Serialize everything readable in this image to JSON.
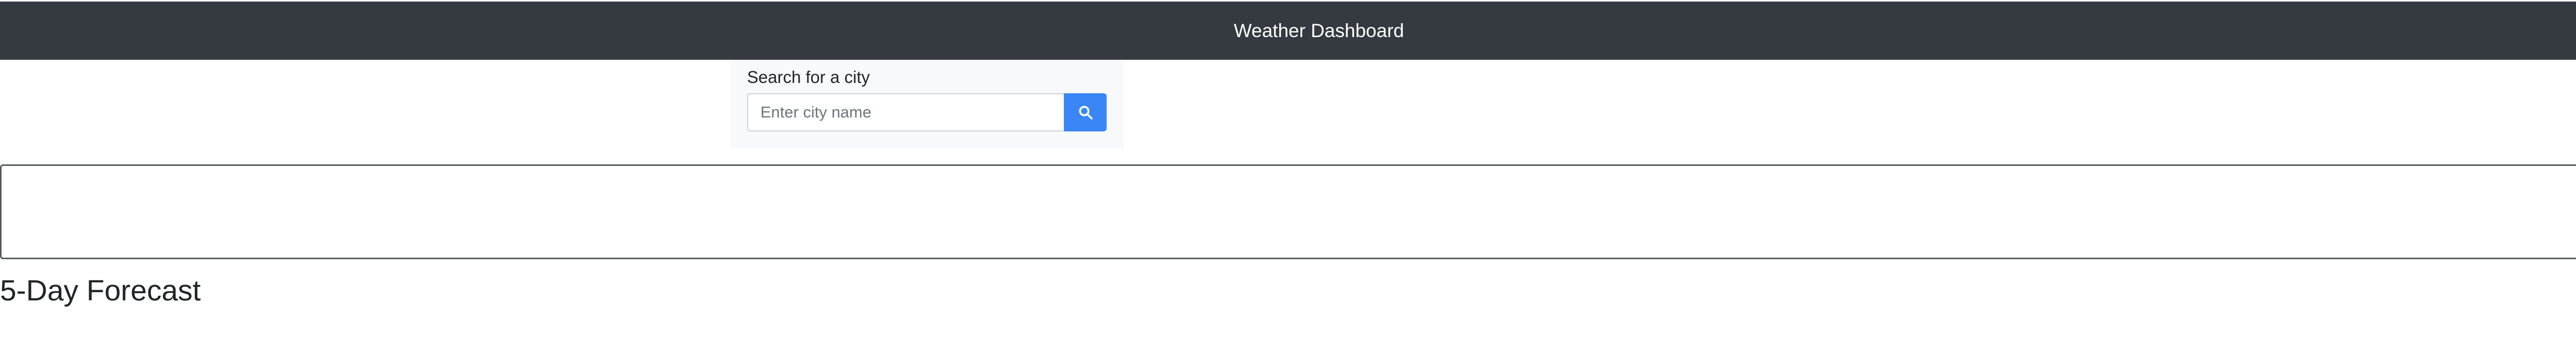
{
  "header": {
    "title": "Weather Dashboard"
  },
  "search": {
    "label": "Search for a city",
    "placeholder": "Enter city name",
    "value": "",
    "button_icon": "search-icon"
  },
  "forecast": {
    "title": "5-Day Forecast"
  },
  "colors": {
    "header_bg": "#343a40",
    "accent": "#3a86f6",
    "panel_bg": "#f8f9fa"
  }
}
